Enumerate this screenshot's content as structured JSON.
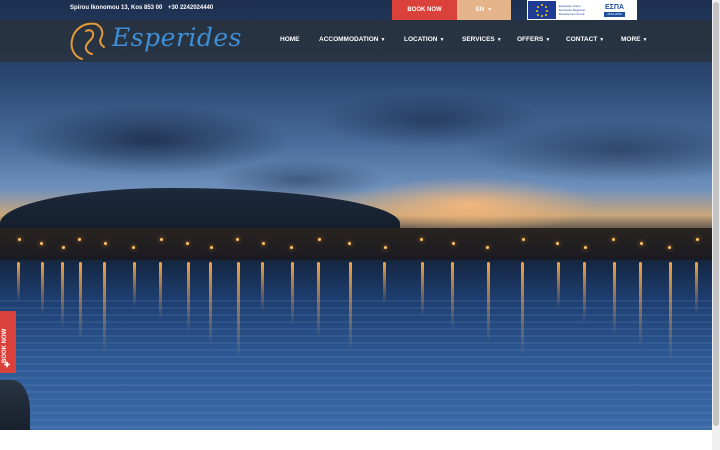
{
  "topbar": {
    "address": "Spirou Ikonomou 13, Kos 853 00",
    "phone": "+30 2242024440",
    "book_now": "BOOK NOW",
    "language": "EN"
  },
  "espa": {
    "eu_text": "European Union European Regional Development Fund",
    "logo_main": "ΕΣΠΑ",
    "logo_years": "2014-2020"
  },
  "brand": {
    "name": "Esperides"
  },
  "nav": {
    "items": [
      {
        "label": "HOME",
        "has_dropdown": false
      },
      {
        "label": "ACCOMMODATION",
        "has_dropdown": true
      },
      {
        "label": "LOCATION",
        "has_dropdown": true
      },
      {
        "label": "SERVICES",
        "has_dropdown": true
      },
      {
        "label": "OFFERS",
        "has_dropdown": true
      },
      {
        "label": "CONTACT",
        "has_dropdown": true
      },
      {
        "label": "MORE",
        "has_dropdown": true
      }
    ]
  },
  "side_tab": {
    "label": "BOOK NOW",
    "icon": "plus-icon"
  },
  "hero": {
    "image": "harbor-at-dusk"
  },
  "colors": {
    "accent_red": "#d9413a",
    "accent_gold": "#e5b48a",
    "header_overlay": "#2a323c",
    "brand_blue": "#3f8fd8"
  }
}
